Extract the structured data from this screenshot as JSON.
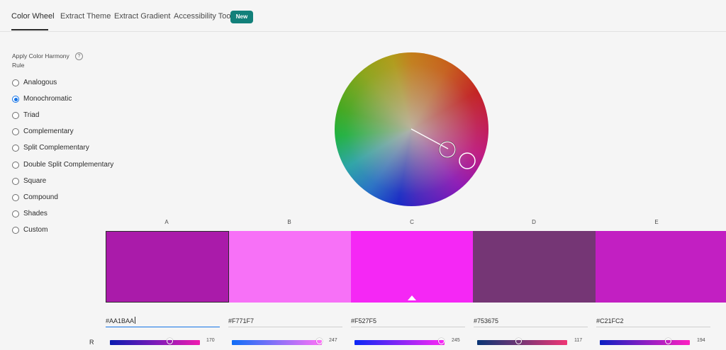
{
  "tabs": [
    {
      "label": "Color Wheel",
      "active": true
    },
    {
      "label": "Extract Theme"
    },
    {
      "label": "Extract Gradient"
    },
    {
      "label": "Accessibility Tools"
    }
  ],
  "badge": "New",
  "harmony": {
    "title": "Apply Color Harmony Rule",
    "help_icon": "question-icon",
    "options": [
      "Analogous",
      "Monochromatic",
      "Triad",
      "Complementary",
      "Split Complementary",
      "Double Split Complementary",
      "Square",
      "Compound",
      "Shades",
      "Custom"
    ],
    "selected": "Monochromatic"
  },
  "swatches": [
    {
      "label": "A",
      "color": "#AA1BAA",
      "hex": "#AA1BAA",
      "r": 170
    },
    {
      "label": "B",
      "color": "#F771F7",
      "hex": "#F771F7",
      "r": 247
    },
    {
      "label": "C",
      "color": "#F527F5",
      "hex": "#F527F5",
      "r": 245
    },
    {
      "label": "D",
      "color": "#753675",
      "hex": "#753675",
      "r": 117
    },
    {
      "label": "E",
      "color": "#C21FC2",
      "hex": "#C21FC2",
      "r": 194
    }
  ],
  "selected_swatch": "A",
  "base_swatch": "C",
  "channel_label": "R",
  "colors": {
    "accent": "#1473e6",
    "badge": "#12807a"
  }
}
